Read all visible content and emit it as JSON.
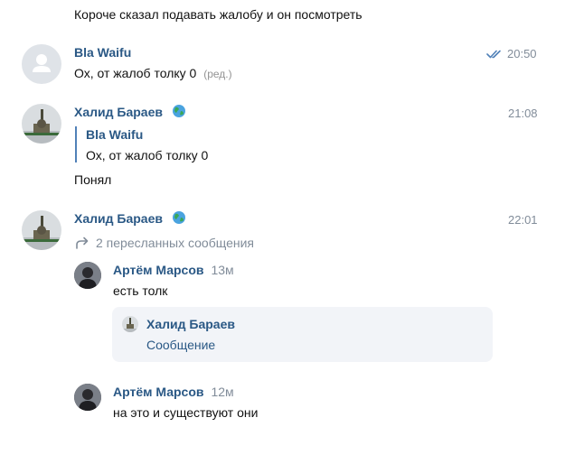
{
  "messages": {
    "prev_text": "Короче сказал подавать жалобу и он посмотреть",
    "msg1": {
      "author": "Bla Waifu",
      "time": "20:50",
      "text": "Ох, от жалоб толку 0",
      "edited": "(ред.)"
    },
    "msg2": {
      "author": "Халид Бараев",
      "time": "21:08",
      "reply_author": "Bla Waifu",
      "reply_text": "Ох, от жалоб толку 0",
      "text": "Понял"
    },
    "msg3": {
      "author": "Халид Бараев",
      "time": "22:01",
      "forwarded_label": "2 пересланных сообщения",
      "fwd1": {
        "author": "Артём Марсов",
        "time": "13м",
        "text": "есть толк",
        "card_author": "Халид Бараев",
        "card_text": "Сообщение"
      },
      "fwd2": {
        "author": "Артём Марсов",
        "time": "12м",
        "text": "на это и существуют они"
      }
    }
  },
  "colors": {
    "name": "#2a5885",
    "time": "#818c99",
    "accent": "#5181b8",
    "card_bg": "#f2f4f8"
  },
  "icons": [
    "user-placeholder-icon",
    "read-checkmarks-icon",
    "globe-emoji-icon",
    "forward-arrow-icon"
  ]
}
